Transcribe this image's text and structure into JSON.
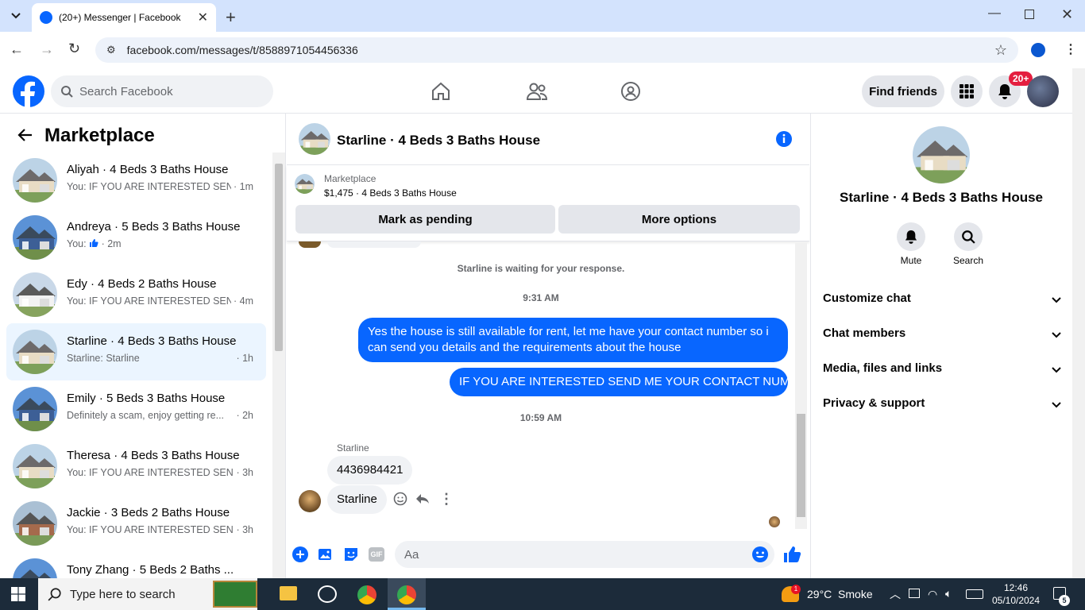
{
  "browser": {
    "tab_title": "(20+) Messenger | Facebook",
    "url": "facebook.com/messages/t/8588971054456336"
  },
  "fb_header": {
    "search_placeholder": "Search Facebook",
    "find_friends": "Find friends",
    "notification_badge": "20+"
  },
  "left": {
    "title": "Marketplace",
    "conversations": [
      {
        "name": "Aliyah · 4 Beds 3 Baths House",
        "preview": "You: IF YOU ARE INTERESTED SEN...",
        "time": "· 1m",
        "house": "beige"
      },
      {
        "name": "Andreya · 5 Beds 3 Baths House",
        "preview": "You:",
        "time": "· 2m",
        "house": "blue"
      },
      {
        "name": "Edy · 4 Beds 2 Baths House",
        "preview": "You: IF YOU ARE INTERESTED SEN...",
        "time": "· 4m",
        "house": "white"
      },
      {
        "name": "Starline · 4 Beds 3 Baths House",
        "preview": "Starline: Starline",
        "time": "· 1h",
        "house": "beige",
        "selected": true
      },
      {
        "name": "Emily · 5 Beds 3 Baths House",
        "preview": "Definitely a scam, enjoy getting re...",
        "time": "· 2h",
        "house": "blue"
      },
      {
        "name": "Theresa · 4 Beds 3 Baths House",
        "preview": "You: IF YOU ARE INTERESTED SEN...",
        "time": "· 3h",
        "house": "beige"
      },
      {
        "name": "Jackie · 3 Beds 2 Baths House",
        "preview": "You: IF YOU ARE INTERESTED SEN...",
        "time": "· 3h",
        "house": "brick"
      },
      {
        "name": "Tony Zhang · 5 Beds 2 Baths ...",
        "preview": "",
        "time": "",
        "house": "blue"
      }
    ]
  },
  "chat": {
    "title": "Starline · 4 Beds 3 Baths House",
    "listing_label": "Marketplace",
    "listing_detail": "$1,475 · 4 Beds 3 Baths House",
    "mark_pending": "Mark as pending",
    "more_options": "More options",
    "waiting": "Starline is waiting for your response.",
    "time1": "9:31 AM",
    "msg1": "Yes the house is still available for rent, let me have your contact number so i can send you details and the requirements about the house",
    "msg2": "IF YOU ARE INTERESTED SEND ME YOUR CONTACT NUMBER",
    "time2": "10:59 AM",
    "sender": "Starline",
    "msg3": "4436984421",
    "msg4": "Starline",
    "composer_placeholder": "Aa",
    "gif_label": "GIF"
  },
  "right": {
    "title": "Starline · 4 Beds 3 Baths House",
    "mute": "Mute",
    "search": "Search",
    "sections": [
      "Customize chat",
      "Chat members",
      "Media, files and links",
      "Privacy & support"
    ]
  },
  "taskbar": {
    "search_placeholder": "Type here to search",
    "weather": "29°C  Smoke",
    "time": "12:46",
    "date": "05/10/2024",
    "weather_badge": "1",
    "notif_count": "5"
  },
  "colors": {
    "accent": "#0866ff",
    "fb_blue": "#0866ff",
    "selected_bg": "#ebf5ff"
  }
}
